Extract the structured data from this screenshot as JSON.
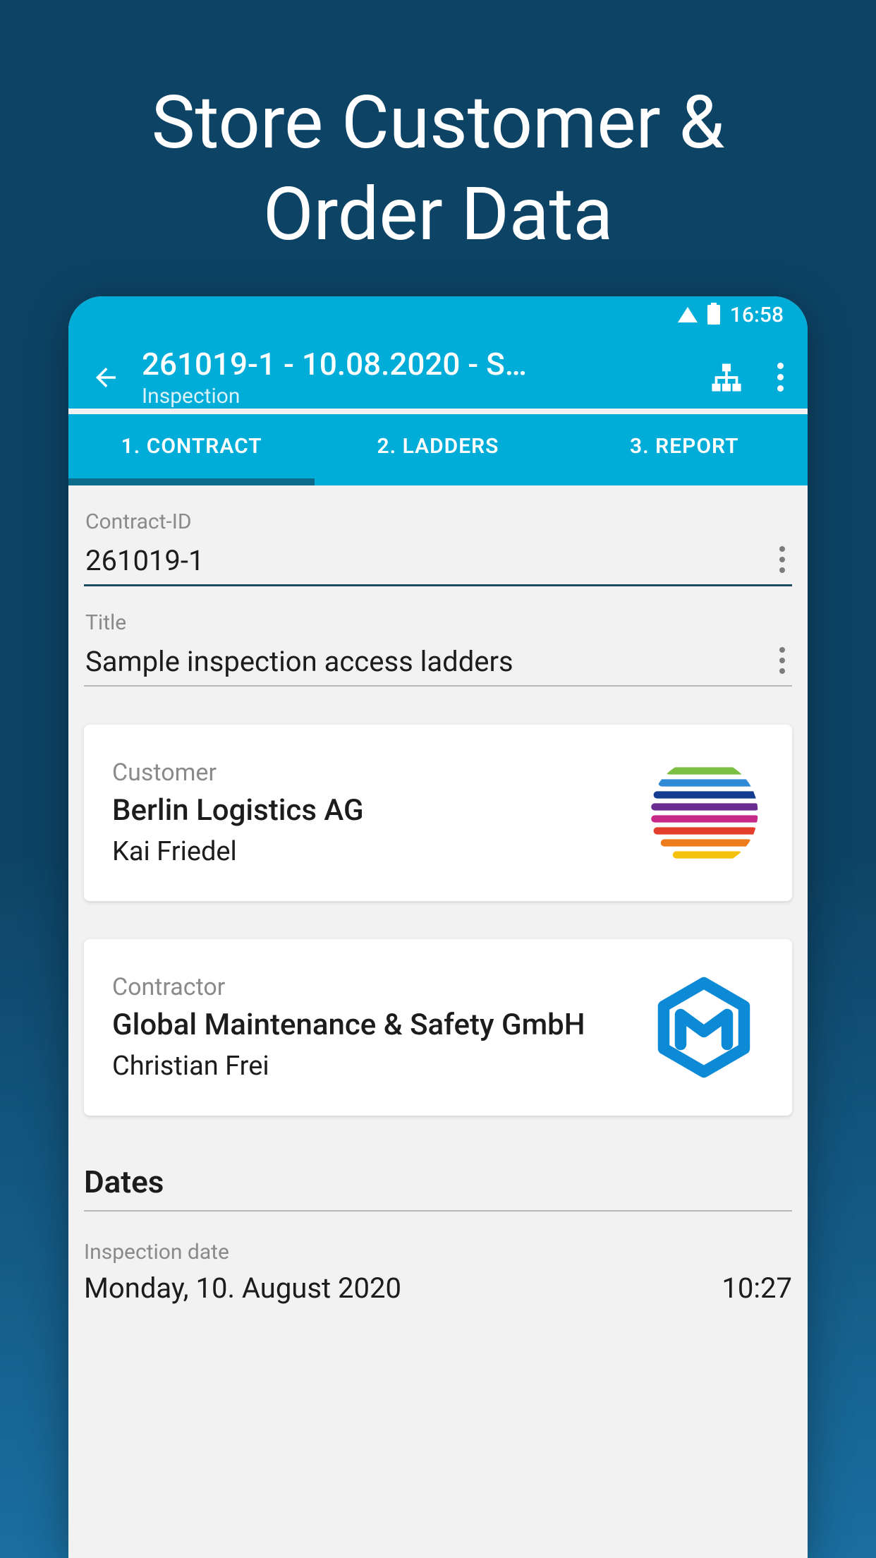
{
  "promo": {
    "title": "Store Customer & Order Data"
  },
  "status": {
    "time": "16:58"
  },
  "appbar": {
    "title": "261019-1 - 10.08.2020 - S…",
    "subtitle": "Inspection"
  },
  "tabs": [
    {
      "label": "1. CONTRACT"
    },
    {
      "label": "2. LADDERS"
    },
    {
      "label": "3. REPORT"
    }
  ],
  "fields": {
    "contract_id": {
      "label": "Contract-ID",
      "value": "261019-1"
    },
    "title": {
      "label": "Title",
      "value": "Sample inspection access ladders"
    }
  },
  "customer": {
    "label": "Customer",
    "company": "Berlin Logistics AG",
    "contact": "Kai Friedel"
  },
  "contractor": {
    "label": "Contractor",
    "company": "Global Maintenance & Safety GmbH",
    "contact": "Christian Frei"
  },
  "dates": {
    "heading": "Dates",
    "inspection_label": "Inspection date",
    "inspection_value": "Monday, 10. August 2020",
    "inspection_time": "10:27"
  }
}
